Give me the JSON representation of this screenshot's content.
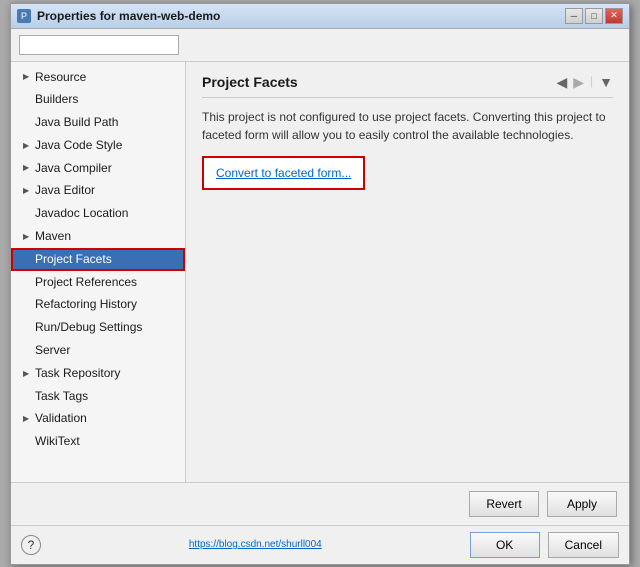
{
  "window": {
    "title": "Properties for maven-web-demo",
    "icon": "P"
  },
  "titleButtons": {
    "minimize": "─",
    "maximize": "□",
    "close": "✕"
  },
  "sidebar": {
    "search_placeholder": "",
    "items": [
      {
        "label": "Resource",
        "arrow": "▶",
        "indented": false,
        "selected": false
      },
      {
        "label": "Builders",
        "arrow": "",
        "indented": false,
        "selected": false
      },
      {
        "label": "Java Build Path",
        "arrow": "",
        "indented": false,
        "selected": false
      },
      {
        "label": "Java Code Style",
        "arrow": "▶",
        "indented": false,
        "selected": false
      },
      {
        "label": "Java Compiler",
        "arrow": "▶",
        "indented": false,
        "selected": false
      },
      {
        "label": "Java Editor",
        "arrow": "▶",
        "indented": false,
        "selected": false
      },
      {
        "label": "Javadoc Location",
        "arrow": "",
        "indented": false,
        "selected": false
      },
      {
        "label": "Maven",
        "arrow": "▶",
        "indented": false,
        "selected": false
      },
      {
        "label": "Project Facets",
        "arrow": "",
        "indented": false,
        "selected": true,
        "highlighted": true
      },
      {
        "label": "Project References",
        "arrow": "",
        "indented": false,
        "selected": false
      },
      {
        "label": "Refactoring History",
        "arrow": "",
        "indented": false,
        "selected": false
      },
      {
        "label": "Run/Debug Settings",
        "arrow": "",
        "indented": false,
        "selected": false
      },
      {
        "label": "Server",
        "arrow": "",
        "indented": false,
        "selected": false
      },
      {
        "label": "Task Repository",
        "arrow": "▶",
        "indented": false,
        "selected": false
      },
      {
        "label": "Task Tags",
        "arrow": "",
        "indented": false,
        "selected": false
      },
      {
        "label": "Validation",
        "arrow": "▶",
        "indented": false,
        "selected": false
      },
      {
        "label": "WikiText",
        "arrow": "",
        "indented": false,
        "selected": false
      }
    ]
  },
  "content": {
    "title": "Project Facets",
    "description": "This project is not configured to use project facets. Converting this project to faceted form will allow you to easily control the available technologies.",
    "convert_link": "Convert to faceted form..."
  },
  "revert_button": "Revert",
  "apply_button": "Apply",
  "ok_button": "OK",
  "cancel_button": "Cancel",
  "footer_link": "https://blog.csdn.net/shurll004",
  "help_icon": "?"
}
